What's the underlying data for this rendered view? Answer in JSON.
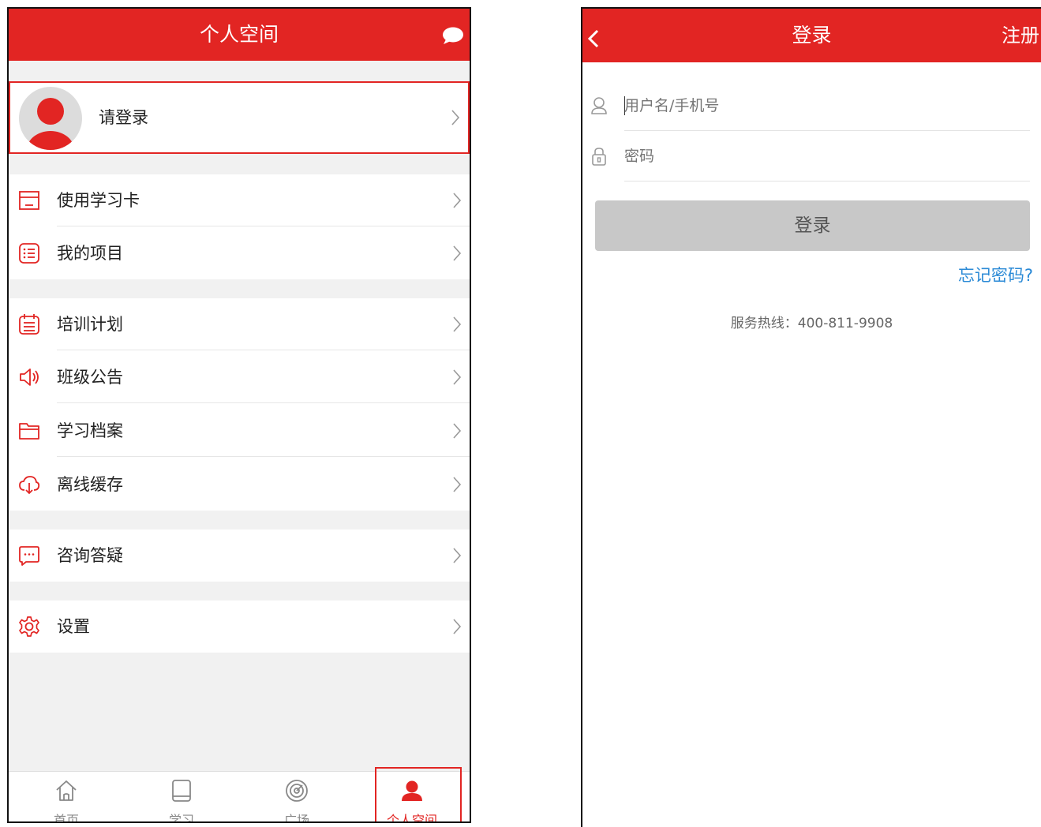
{
  "left": {
    "header": {
      "title": "个人空间",
      "chat_icon": "chat-bubble-icon"
    },
    "profile": {
      "label": "请登录"
    },
    "menu_groups": [
      [
        {
          "label": "使用学习卡",
          "icon": "card-icon"
        },
        {
          "label": "我的项目",
          "icon": "list-icon"
        }
      ],
      [
        {
          "label": "培训计划",
          "icon": "calendar-icon"
        },
        {
          "label": "班级公告",
          "icon": "speaker-icon"
        },
        {
          "label": "学习档案",
          "icon": "folder-icon"
        },
        {
          "label": "离线缓存",
          "icon": "cloud-download-icon"
        }
      ],
      [
        {
          "label": "咨询答疑",
          "icon": "chat-dots-icon"
        }
      ],
      [
        {
          "label": "设置",
          "icon": "gear-icon"
        }
      ]
    ],
    "tabs": [
      {
        "label": "首页",
        "icon": "home-icon"
      },
      {
        "label": "学习",
        "icon": "book-icon"
      },
      {
        "label": "广场",
        "icon": "target-icon"
      },
      {
        "label": "个人空间",
        "icon": "user-icon",
        "active": true
      }
    ]
  },
  "right": {
    "header": {
      "title": "登录",
      "action": "注册",
      "back_icon": "back-arrow-icon"
    },
    "username": {
      "placeholder": "用户名/手机号",
      "icon": "user-outline-icon"
    },
    "password": {
      "placeholder": "密码",
      "icon": "lock-icon"
    },
    "login_button": "登录",
    "forgot_link": "忘记密码?",
    "hotline": "服务热线：400-811-9908"
  },
  "colors": {
    "brand_red": "#e22523",
    "link_blue": "#2b8ad6",
    "disabled_gray": "#c8c8c8"
  }
}
